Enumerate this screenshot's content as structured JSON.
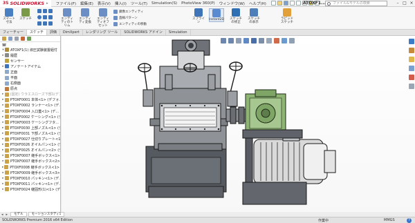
{
  "app": {
    "logo_ds": "3S",
    "logo_text": "SOLIDWORKS",
    "document_title": "ATOXF1..."
  },
  "menubar": {
    "items": [
      "ファイル(F)",
      "編集(E)",
      "表示(V)",
      "挿入(I)",
      "ツール(T)",
      "Simulation(S)",
      "PhotoView 360(P)",
      "ウィンドウ(W)",
      "ヘルプ(H)"
    ]
  },
  "search": {
    "placeholder": "ファイル&モデルの検索"
  },
  "ribbon": {
    "large": [
      {
        "label": "スマート寸法",
        "icon": "smart-dimension-icon",
        "color": "#4a7fc1"
      },
      {
        "label": "スケッチ",
        "icon": "sketch-icon",
        "color": "#7a9a4a"
      },
      {
        "label": "エンティティ変換",
        "icon": "convert-entities-icon",
        "color": "#6b8fc4"
      },
      {
        "label": "エンティティオフセット",
        "icon": "offset-entities-icon",
        "color": "#6b8fc4"
      },
      {
        "label": "スプライン",
        "icon": "spline-icon",
        "color": "#3f74b8"
      },
      {
        "label": "Instant2D",
        "icon": "instant2d-icon",
        "color": "#5a8ad0"
      },
      {
        "label": "スケッチの修正",
        "icon": "repair-sketch-icon",
        "color": "#2f6fb4"
      },
      {
        "label": "スケッチの表示",
        "icon": "quick-snaps-icon",
        "color": "#4f7fb9"
      },
      {
        "label": "ラピッドスケッチ",
        "icon": "rapid-sketch-icon",
        "color": "#e2a03a"
      }
    ],
    "small": [
      {
        "label": "エンティティのトリム",
        "icon": "trim-icon"
      },
      {
        "label": "鏡像エンティティ",
        "icon": "mirror-icon"
      },
      {
        "label": "直線パターン",
        "icon": "linear-pattern-icon"
      },
      {
        "label": "エンティティの移動",
        "icon": "move-entities-icon"
      }
    ]
  },
  "command_tabs": [
    "フィーチャー",
    "スケッチ",
    "評価",
    "DimXpert",
    "レンダリング ツール",
    "SOLIDWORKS アドイン",
    "Simulation"
  ],
  "active_command_tab": 1,
  "feature_tree": [
    {
      "label": "ATOXF1(1) 液圧試験装置組付",
      "expand": "▾",
      "dim": false,
      "color": "#b08a3a"
    },
    {
      "label": "履歴",
      "expand": "▸",
      "dim": false,
      "color": "#8a8a8a"
    },
    {
      "label": "センサー",
      "expand": "",
      "dim": false,
      "color": "#c0a23a"
    },
    {
      "label": "アノテートアイテム",
      "expand": "▸",
      "dim": false,
      "color": "#3f74b8"
    },
    {
      "label": "正面",
      "expand": "",
      "dim": false,
      "color": "#8fa9c9"
    },
    {
      "label": "平面",
      "expand": "",
      "dim": false,
      "color": "#8fa9c9"
    },
    {
      "label": "右側面",
      "expand": "",
      "dim": false,
      "color": "#8fa9c9"
    },
    {
      "label": "原点",
      "expand": "",
      "dim": false,
      "color": "#c07a3a"
    },
    {
      "label": "(固定) ウラエスローズ下部1(デフ...",
      "expand": "▸",
      "dim": true,
      "color": "#c9a24a"
    },
    {
      "label": "PTOXF0001 本体<1> (デフォ...",
      "expand": "▸",
      "dim": false,
      "color": "#c9a24a"
    },
    {
      "label": "PTOXF0002 ランナー<1> (デ...",
      "expand": "▸",
      "dim": false,
      "color": "#c9a24a"
    },
    {
      "label": "PTOXF0004 入口蓋<1> (デ...",
      "expand": "▸",
      "dim": false,
      "color": "#c9a24a"
    },
    {
      "label": "PTOXF0002 ケーシング<1> (デ...",
      "expand": "▸",
      "dim": false,
      "color": "#c9a24a"
    },
    {
      "label": "PTOXF0003 ケーシングフタ...",
      "expand": "▸",
      "dim": false,
      "color": "#c9a24a"
    },
    {
      "label": "PTOXF0030 上部ノズル<1> (デ...",
      "expand": "▸",
      "dim": false,
      "color": "#c9a24a"
    },
    {
      "label": "PTOXF0031 下部ノズル<1> (デ...",
      "expand": "▸",
      "dim": false,
      "color": "#c9a24a"
    },
    {
      "label": "PTOXF0027 仕切りプレート<1>",
      "expand": "▸",
      "dim": false,
      "color": "#c9a24a"
    },
    {
      "label": "PTOXF0026 オイルパン<1> (デ...",
      "expand": "▸",
      "dim": false,
      "color": "#c9a24a"
    },
    {
      "label": "PTOXF0025 オイルパン<2> (デ...",
      "expand": "▸",
      "dim": false,
      "color": "#c9a24a"
    },
    {
      "label": "PTOXF0007 継手ボックス<1>",
      "expand": "▸",
      "dim": false,
      "color": "#c9a24a"
    },
    {
      "label": "PTOXF0007 継手ボックス<2>",
      "expand": "▸",
      "dim": false,
      "color": "#c9a24a"
    },
    {
      "label": "PTOXF0008 継手ボックス<1> (デ...",
      "expand": "▸",
      "dim": false,
      "color": "#c9a24a"
    },
    {
      "label": "PTOXF0009 継手ボックス<3>",
      "expand": "▸",
      "dim": false,
      "color": "#c9a24a"
    },
    {
      "label": "PTOXF0010 パッキン<1> (デ...",
      "expand": "▸",
      "dim": false,
      "color": "#c9a24a"
    },
    {
      "label": "PTOXF0011 パッキン<1> (デ...",
      "expand": "▸",
      "dim": false,
      "color": "#c9a24a"
    },
    {
      "label": "PTOXF0024 継固形(1)<1> (デ...",
      "expand": "▸",
      "dim": false,
      "color": "#c9a24a"
    }
  ],
  "model_tabs": [
    "モデル",
    "モーションスタディ1"
  ],
  "status": {
    "left": "SOLIDWORKS Premium 2016 x64 Edition",
    "edit": "作業中",
    "units": "MMGS",
    "help": "?"
  },
  "colors": {
    "accent": "#c8102e",
    "gearbox_green": "#8fb574",
    "motor_grey": "#d9d9d9"
  }
}
